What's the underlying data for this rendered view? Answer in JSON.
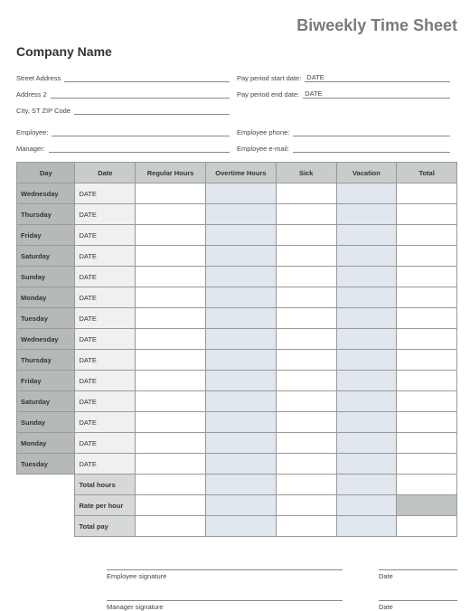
{
  "title": "Biweekly Time Sheet",
  "company": "Company Name",
  "address_labels": {
    "street": "Street Address",
    "address2": "Address 2",
    "city_st_zip": "CIty, ST  ZIP Code"
  },
  "period_labels": {
    "start": "Pay period start date:",
    "end": "Pay period end date:"
  },
  "period_values": {
    "start": "DATE",
    "end": "DATE"
  },
  "contact_labels": {
    "employee": "Employee:",
    "manager": "Manager:",
    "phone": "Employee phone:",
    "email": "Employee e-mail:"
  },
  "columns": {
    "day": "Day",
    "date": "Date",
    "regular": "Regular Hours",
    "overtime": "Overtime Hours",
    "sick": "Sick",
    "vacation": "Vacation",
    "total": "Total"
  },
  "rows": [
    {
      "day": "Wednesday",
      "date": "DATE"
    },
    {
      "day": "Thursday",
      "date": "DATE"
    },
    {
      "day": "Friday",
      "date": "DATE"
    },
    {
      "day": "Saturday",
      "date": "DATE"
    },
    {
      "day": "Sunday",
      "date": "DATE"
    },
    {
      "day": "Monday",
      "date": "DATE"
    },
    {
      "day": "Tuesday",
      "date": "DATE"
    },
    {
      "day": "Wednesday",
      "date": "DATE"
    },
    {
      "day": "Thursday",
      "date": "DATE"
    },
    {
      "day": "Friday",
      "date": "DATE"
    },
    {
      "day": "Saturday",
      "date": "DATE"
    },
    {
      "day": "Sunday",
      "date": "DATE"
    },
    {
      "day": "Monday",
      "date": "DATE"
    },
    {
      "day": "Tuesday",
      "date": "DATE"
    }
  ],
  "summary_labels": {
    "total_hours": "Total hours",
    "rate": "Rate per hour",
    "total_pay": "Total pay"
  },
  "signatures": {
    "employee": "Employee signature",
    "manager": "Manager signature",
    "date": "Date"
  }
}
